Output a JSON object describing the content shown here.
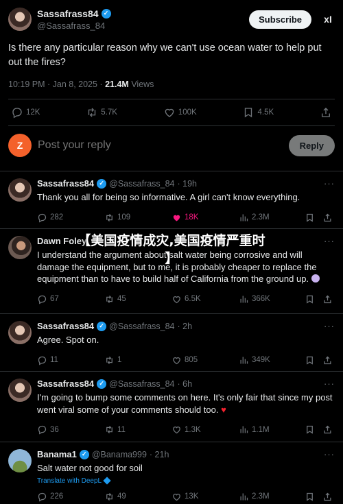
{
  "main_post": {
    "display_name": "Sassafrass84",
    "handle": "@Sassafrass_84",
    "subscribe_label": "Subscribe",
    "grok_label": "xI",
    "text": "Is there any particular reason why we can't use ocean water to help put out the fires?",
    "time": "10:19 PM · Jan 8, 2025 ·",
    "views_count": "21.4M",
    "views_label": "Views",
    "stats": {
      "replies": "12K",
      "reposts": "5.7K",
      "likes": "100K",
      "bookmarks": "4.5K"
    }
  },
  "composer": {
    "avatar_letter": "Z",
    "placeholder": "Post your reply",
    "reply_label": "Reply"
  },
  "overlay": {
    "line1": "【美国疫情成灾,美国疫情严重时",
    "line2": "】"
  },
  "replies": [
    {
      "display_name": "Sassafrass84",
      "handle": "@Sassafrass_84",
      "time": "· 19h",
      "text": "Thank you all for being so informative. A girl can't know everything.",
      "replies": "282",
      "reposts": "109",
      "likes": "18K",
      "views": "2.3M"
    },
    {
      "display_name": "Dawn Foley",
      "handle": "",
      "time": "",
      "text": "I understand the argument about salt water being corrosive and will damage the equipment, but to me, it is probably cheaper to replace the equipment than to have to build half of California from the ground up.",
      "replies": "67",
      "reposts": "45",
      "likes": "6.5K",
      "views": "366K"
    },
    {
      "display_name": "Sassafrass84",
      "handle": "@Sassafrass_84",
      "time": "· 2h",
      "text": "Agree. Spot on.",
      "replies": "11",
      "reposts": "1",
      "likes": "805",
      "views": "349K"
    },
    {
      "display_name": "Sassafrass84",
      "handle": "@Sassafrass_84",
      "time": "· 6h",
      "text": "I'm going to bump some comments on here. It's only fair that since my post went viral some of your comments should too.",
      "replies": "36",
      "reposts": "11",
      "likes": "1.3K",
      "views": "1.1M"
    },
    {
      "display_name": "Banama1",
      "handle": "@Banama999",
      "time": "· 21h",
      "text": "Salt water not good for soil",
      "translate": "Translate with DeepL",
      "replies": "226",
      "reposts": "49",
      "likes": "13K",
      "views": "2.3M"
    }
  ],
  "colors": {
    "accent": "#1d9bf0",
    "like": "#f91880",
    "muted": "#71767b",
    "background": "#000000"
  }
}
